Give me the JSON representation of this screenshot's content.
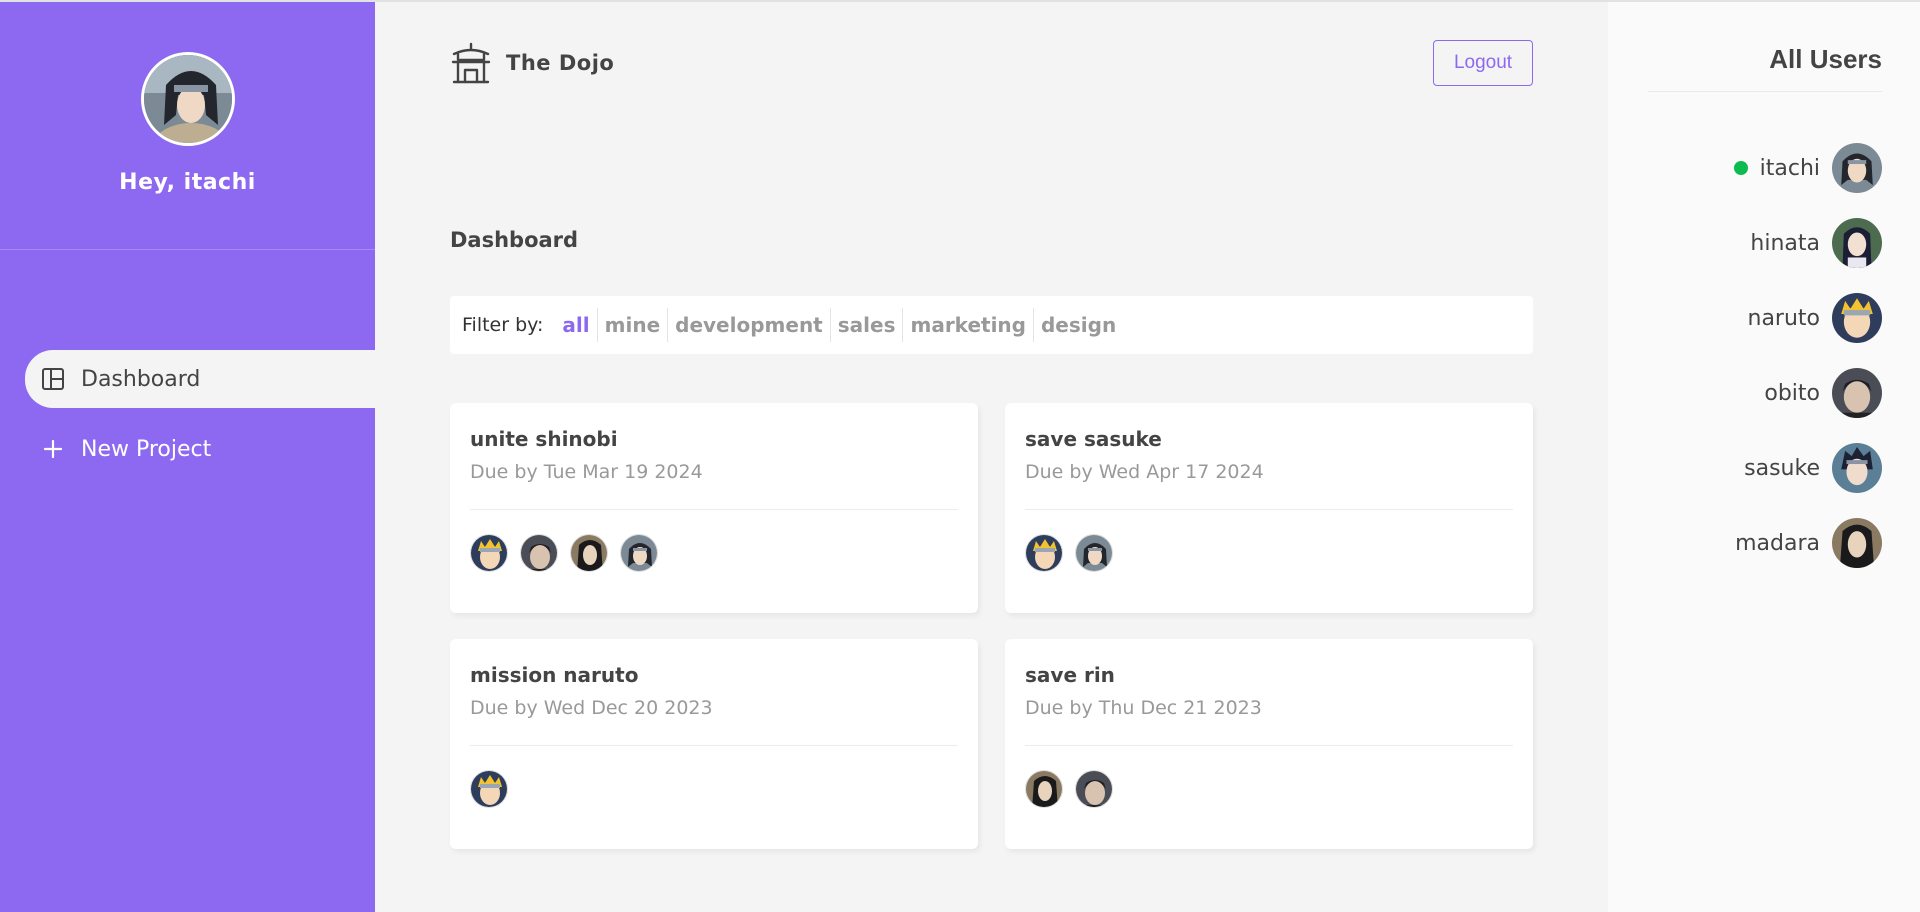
{
  "sidebar": {
    "greeting": "Hey, itachi",
    "avatar": "itachi-avatar",
    "nav": [
      {
        "label": "Dashboard",
        "icon": "dashboard-icon"
      },
      {
        "label": "New Project",
        "icon": "plus-icon"
      }
    ]
  },
  "navbar": {
    "brand": "The Dojo",
    "logo": "temple-icon",
    "logout_label": "Logout"
  },
  "main": {
    "title": "Dashboard",
    "filter": {
      "label": "Filter by:",
      "options": [
        "all",
        "mine",
        "development",
        "sales",
        "marketing",
        "design"
      ],
      "selected": "all"
    },
    "projects": [
      {
        "title": "unite shinobi",
        "due": "Due by Tue Mar 19 2024",
        "assigned": [
          "naruto",
          "obito",
          "madara",
          "itachi"
        ]
      },
      {
        "title": "save sasuke",
        "due": "Due by Wed Apr 17 2024",
        "assigned": [
          "naruto",
          "itachi"
        ]
      },
      {
        "title": "mission naruto",
        "due": "Due by Wed Dec 20 2023",
        "assigned": [
          "naruto"
        ]
      },
      {
        "title": "save rin",
        "due": "Due by Thu Dec 21 2023",
        "assigned": [
          "madara",
          "obito"
        ]
      }
    ]
  },
  "users": {
    "title": "All Users",
    "list": [
      {
        "name": "itachi",
        "online": true
      },
      {
        "name": "hinata",
        "online": false
      },
      {
        "name": "naruto",
        "online": false
      },
      {
        "name": "obito",
        "online": false
      },
      {
        "name": "sasuke",
        "online": false
      },
      {
        "name": "madara",
        "online": false
      }
    ]
  },
  "colors": {
    "accent": "#8d69f1",
    "online": "#0ebb50",
    "background": "#f4f4f4"
  }
}
